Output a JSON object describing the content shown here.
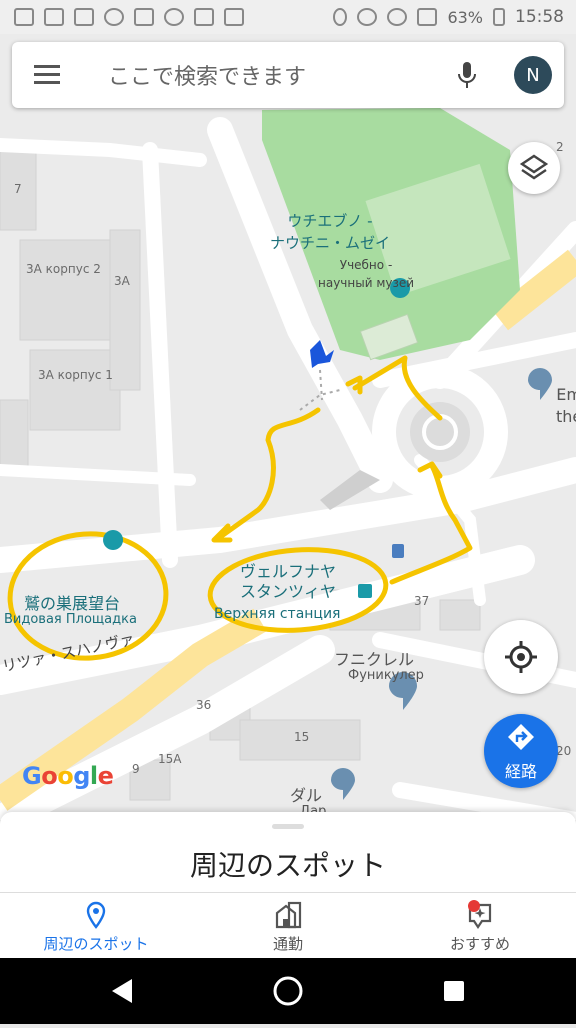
{
  "status_bar": {
    "battery": "63%",
    "time": "15:58"
  },
  "search": {
    "placeholder": "ここで検索できます",
    "avatar_initial": "N"
  },
  "map": {
    "places": [
      {
        "id": "museum",
        "name_ja": "ウチエブノ -\nナウチニ・ムゼイ",
        "name_ru": "Учебно -\nнаучный музей"
      },
      {
        "id": "viewpoint",
        "name_ja": "鷲の巣展望台",
        "name_ru": "Видовая Площадка"
      },
      {
        "id": "station",
        "name_ja": "ヴェルフナヤ\nスタンツィヤ",
        "name_ru": "Верхняя станция"
      },
      {
        "id": "funicular",
        "name_ja": "フニクレル",
        "name_ru": "Фуникулер"
      },
      {
        "id": "dal",
        "name_ja": "ダル",
        "name_ru": "Дар"
      },
      {
        "id": "emth",
        "name_ja": "Em\nthe",
        "name_ru": ""
      }
    ],
    "building_labels": [
      "3А корпус 2",
      "3А",
      "3А корпус 1",
      "3А",
      "37",
      "36",
      "15",
      "15А",
      "9",
      "20",
      "7",
      "3",
      "2"
    ],
    "street_label": "リツァ・スハノヴァ",
    "annotation_color": "#f5c400",
    "water_color": "#1a6f7a"
  },
  "buttons": {
    "route_label": "経路"
  },
  "google_logo": [
    "G",
    "o",
    "o",
    "g",
    "l",
    "e"
  ],
  "bottom_sheet": {
    "title": "周辺のスポット"
  },
  "bottom_nav": [
    {
      "label": "周辺のスポット",
      "icon": "pin-icon",
      "active": true
    },
    {
      "label": "通勤",
      "icon": "commute-icon",
      "active": false
    },
    {
      "label": "おすすめ",
      "icon": "sparkle-icon",
      "active": false
    }
  ],
  "colors": {
    "accent": "#1a73e8",
    "park": "#a8dca0",
    "road_yellow": "#fde49a"
  }
}
